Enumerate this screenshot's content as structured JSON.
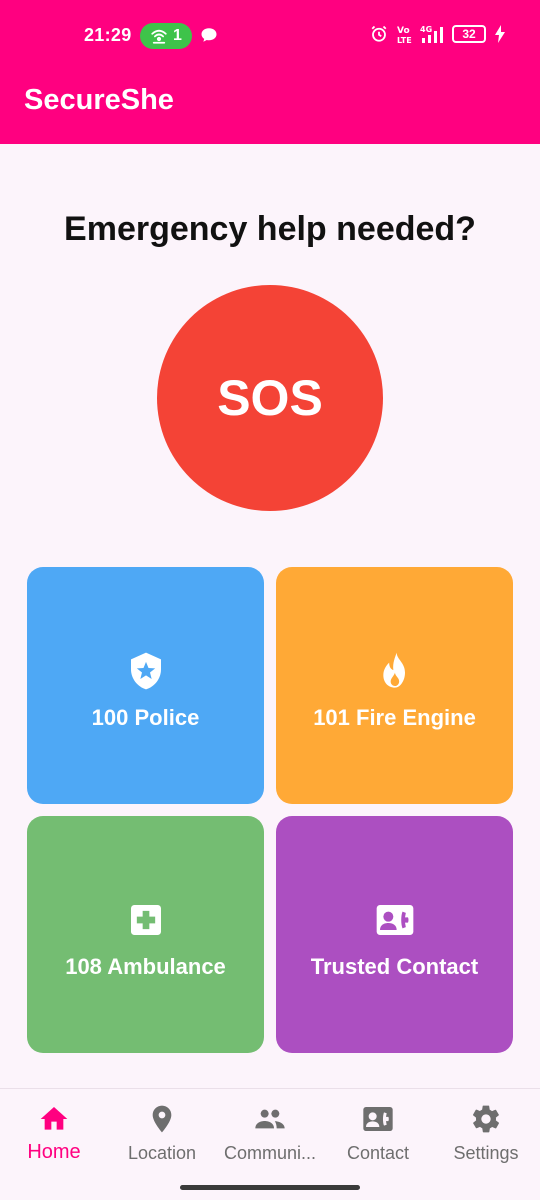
{
  "status_bar": {
    "time": "21:29",
    "hotspot_count": "1",
    "battery": "32"
  },
  "app": {
    "title": "SecureShe"
  },
  "main": {
    "headline": "Emergency help needed?",
    "sos_label": "SOS",
    "tiles": [
      {
        "label": "100 Police",
        "icon": "police-shield-icon",
        "color": "#4ea8f5"
      },
      {
        "label": "101 Fire Engine",
        "icon": "fire-icon",
        "color": "#ffa936"
      },
      {
        "label": "108 Ambulance",
        "icon": "medical-cross-icon",
        "color": "#74bd72"
      },
      {
        "label": "Trusted Contact",
        "icon": "contact-phone-icon",
        "color": "#ac4fc1"
      }
    ]
  },
  "bottom_nav": {
    "items": [
      {
        "label": "Home",
        "icon": "home-icon",
        "active": true
      },
      {
        "label": "Location",
        "icon": "location-pin-icon"
      },
      {
        "label": "Communi...",
        "icon": "people-icon"
      },
      {
        "label": "Contact",
        "icon": "contact-card-icon"
      },
      {
        "label": "Settings",
        "icon": "gear-icon"
      }
    ]
  },
  "colors": {
    "brand": "#ff0080",
    "sos": "#f44336",
    "background": "#fcf4fb"
  }
}
